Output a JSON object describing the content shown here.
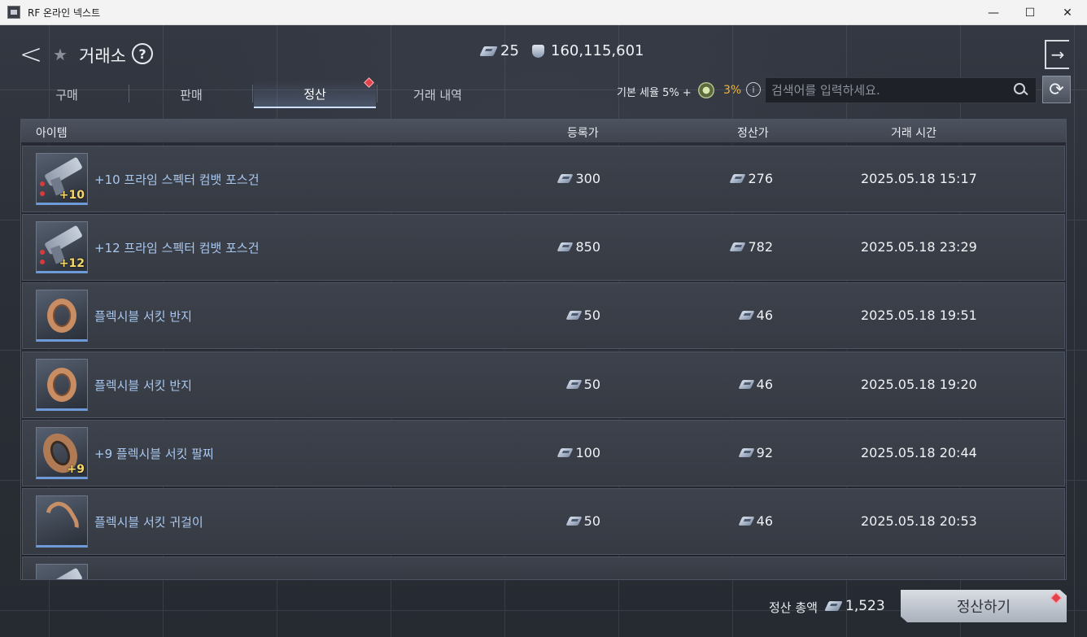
{
  "window": {
    "title": "RF 온라인 넥스트",
    "min_icon": "—",
    "max_icon": "☐",
    "close_icon": "✕"
  },
  "header": {
    "back_icon": "<",
    "title": "거래소",
    "help_icon": "?",
    "gem_amount": "25",
    "coin_amount": "160,115,601",
    "exit_icon": "→"
  },
  "tabs": [
    {
      "label": "구매"
    },
    {
      "label": "판매"
    },
    {
      "label": "정산"
    },
    {
      "label": "거래 내역"
    }
  ],
  "tax": {
    "label": "기본 세율 5% +",
    "value": "3%",
    "info_icon": "i"
  },
  "search": {
    "placeholder": "검색어를 입력하세요."
  },
  "refresh_icon": "⟳",
  "table": {
    "headers": {
      "item": "아이템",
      "registered_price": "등록가",
      "settlement_price": "정산가",
      "trade_time": "거래 시간"
    },
    "rows": [
      {
        "name": "+10 프라임 스펙터 컴뱃 포스건",
        "type": "gun",
        "enhance": "+10",
        "registered": "300",
        "settled": "276",
        "time": "2025.05.18 15:17"
      },
      {
        "name": "+12 프라임 스펙터 컴뱃 포스건",
        "type": "gun",
        "enhance": "+12",
        "registered": "850",
        "settled": "782",
        "time": "2025.05.18 23:29"
      },
      {
        "name": "플렉시블 서킷 반지",
        "type": "ring",
        "enhance": "",
        "registered": "50",
        "settled": "46",
        "time": "2025.05.18 19:51"
      },
      {
        "name": "플렉시블 서킷 반지",
        "type": "ring",
        "enhance": "",
        "registered": "50",
        "settled": "46",
        "time": "2025.05.18 19:20"
      },
      {
        "name": "+9 플렉시블 서킷 팔찌",
        "type": "bracelet",
        "enhance": "+9",
        "registered": "100",
        "settled": "92",
        "time": "2025.05.18 20:44"
      },
      {
        "name": "플렉시블 서킷 귀걸이",
        "type": "earring",
        "enhance": "",
        "registered": "50",
        "settled": "46",
        "time": "2025.05.18 20:53"
      }
    ]
  },
  "footer": {
    "total_label": "정산 총액",
    "total_value": "1,523",
    "settle_button": "정산하기"
  }
}
